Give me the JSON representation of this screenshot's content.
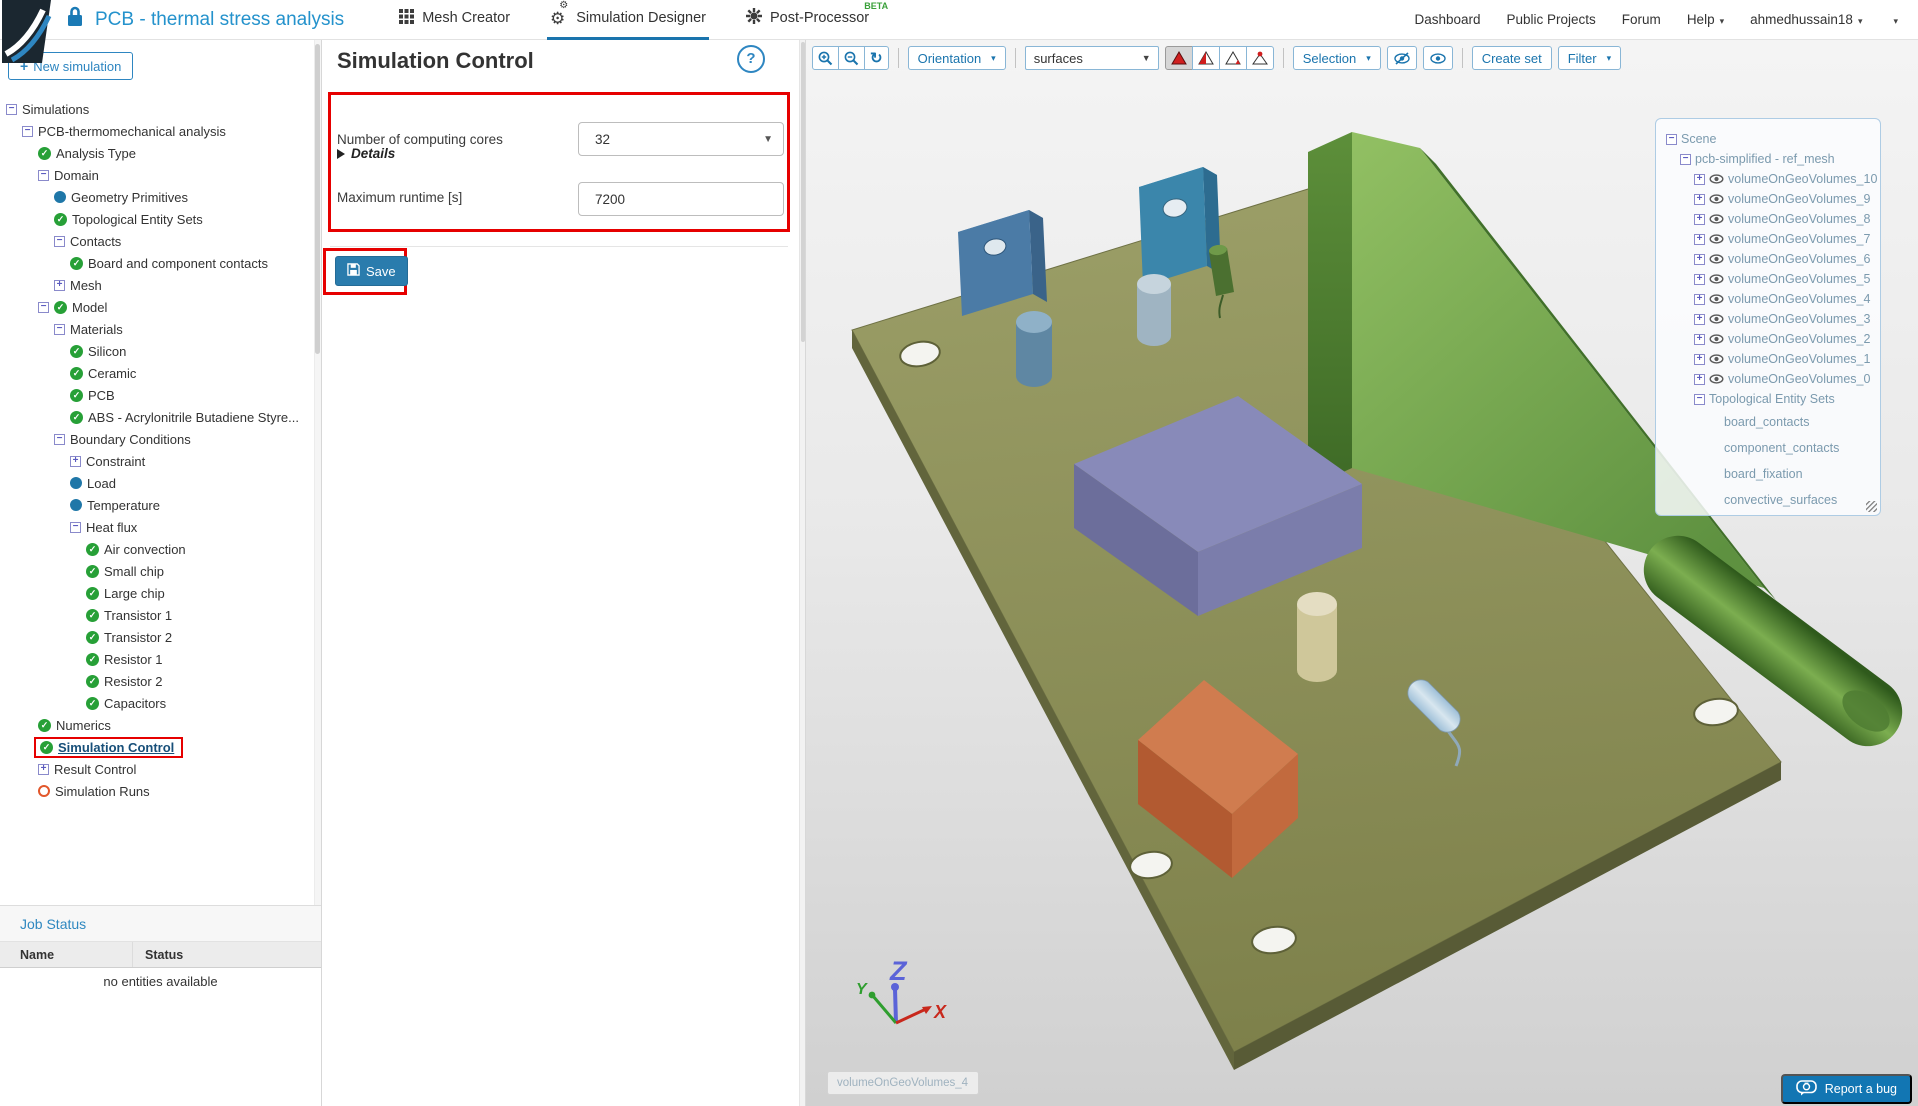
{
  "header": {
    "title": "PCB - thermal stress analysis",
    "tabs": [
      {
        "label": "Mesh Creator"
      },
      {
        "label": "Simulation Designer"
      },
      {
        "label": "Post-Processor",
        "badge": "BETA"
      }
    ],
    "nav": [
      "Dashboard",
      "Public Projects",
      "Forum",
      "Help",
      "ahmedhussain18"
    ]
  },
  "sidebar": {
    "new_simulation": "New simulation",
    "tree": [
      {
        "label": "Simulations",
        "level": 0,
        "icons": [
          "minus"
        ]
      },
      {
        "label": "PCB-thermomechanical analysis",
        "level": 1,
        "icons": [
          "minus"
        ]
      },
      {
        "label": "Analysis Type",
        "level": 2,
        "icons": [
          "check"
        ]
      },
      {
        "label": "Domain",
        "level": 2,
        "icons": [
          "minus"
        ]
      },
      {
        "label": "Geometry Primitives",
        "level": 3,
        "icons": [
          "dot"
        ]
      },
      {
        "label": "Topological Entity Sets",
        "level": 3,
        "icons": [
          "check"
        ]
      },
      {
        "label": "Contacts",
        "level": 3,
        "icons": [
          "minus"
        ]
      },
      {
        "label": "Board and component contacts",
        "level": 4,
        "icons": [
          "check"
        ]
      },
      {
        "label": "Mesh",
        "level": 3,
        "icons": [
          "plus"
        ]
      },
      {
        "label": "Model",
        "level": 2,
        "icons": [
          "minus",
          "check"
        ]
      },
      {
        "label": "Materials",
        "level": 3,
        "icons": [
          "minus"
        ]
      },
      {
        "label": "Silicon",
        "level": 4,
        "icons": [
          "check"
        ]
      },
      {
        "label": "Ceramic",
        "level": 4,
        "icons": [
          "check"
        ]
      },
      {
        "label": "PCB",
        "level": 4,
        "icons": [
          "check"
        ]
      },
      {
        "label": "ABS - Acrylonitrile Butadiene Styre...",
        "level": 4,
        "icons": [
          "check"
        ]
      },
      {
        "label": "Boundary Conditions",
        "level": 3,
        "icons": [
          "minus"
        ]
      },
      {
        "label": "Constraint",
        "level": 4,
        "icons": [
          "plus"
        ]
      },
      {
        "label": "Load",
        "level": 4,
        "icons": [
          "dot"
        ]
      },
      {
        "label": "Temperature",
        "level": 4,
        "icons": [
          "dot"
        ]
      },
      {
        "label": "Heat flux",
        "level": 4,
        "icons": [
          "minus"
        ]
      },
      {
        "label": "Air convection",
        "level": 5,
        "icons": [
          "check"
        ]
      },
      {
        "label": "Small chip",
        "level": 5,
        "icons": [
          "check"
        ]
      },
      {
        "label": "Large chip",
        "level": 5,
        "icons": [
          "check"
        ]
      },
      {
        "label": "Transistor 1",
        "level": 5,
        "icons": [
          "check"
        ]
      },
      {
        "label": "Transistor 2",
        "level": 5,
        "icons": [
          "check"
        ]
      },
      {
        "label": "Resistor 1",
        "level": 5,
        "icons": [
          "check"
        ]
      },
      {
        "label": "Resistor 2",
        "level": 5,
        "icons": [
          "check"
        ]
      },
      {
        "label": "Capacitors",
        "level": 5,
        "icons": [
          "check"
        ]
      },
      {
        "label": "Numerics",
        "level": 2,
        "icons": [
          "check"
        ]
      },
      {
        "label": "Simulation Control",
        "level": 2,
        "icons": [
          "check"
        ],
        "selected": true
      },
      {
        "label": "Result Control",
        "level": 2,
        "icons": [
          "plus"
        ]
      },
      {
        "label": "Simulation Runs",
        "level": 2,
        "icons": [
          "ring"
        ]
      }
    ],
    "job_status": {
      "title": "Job Status",
      "name_col": "Name",
      "status_col": "Status",
      "empty": "no entities available"
    }
  },
  "panel": {
    "title": "Simulation Control",
    "help": "?",
    "cores_label": "Number of computing cores",
    "cores_value": "32",
    "details_label": "Details",
    "runtime_label": "Maximum runtime [s]",
    "runtime_value": "7200",
    "save_label": "Save"
  },
  "viewport": {
    "toolbar": {
      "orientation": "Orientation",
      "surfaces": "surfaces",
      "selection": "Selection",
      "create_set": "Create set",
      "filter": "Filter"
    },
    "scene": [
      {
        "label": "Scene",
        "level": 0,
        "icons": [
          "minus"
        ]
      },
      {
        "label": "pcb-simplified - ref_mesh",
        "level": 1,
        "icons": [
          "minus"
        ]
      },
      {
        "label": "volumeOnGeoVolumes_10",
        "level": 2,
        "icons": [
          "plus",
          "eye"
        ]
      },
      {
        "label": "volumeOnGeoVolumes_9",
        "level": 2,
        "icons": [
          "plus",
          "eye"
        ]
      },
      {
        "label": "volumeOnGeoVolumes_8",
        "level": 2,
        "icons": [
          "plus",
          "eye"
        ]
      },
      {
        "label": "volumeOnGeoVolumes_7",
        "level": 2,
        "icons": [
          "plus",
          "eye"
        ]
      },
      {
        "label": "volumeOnGeoVolumes_6",
        "level": 2,
        "icons": [
          "plus",
          "eye"
        ]
      },
      {
        "label": "volumeOnGeoVolumes_5",
        "level": 2,
        "icons": [
          "plus",
          "eye"
        ]
      },
      {
        "label": "volumeOnGeoVolumes_4",
        "level": 2,
        "icons": [
          "plus",
          "eye"
        ]
      },
      {
        "label": "volumeOnGeoVolumes_3",
        "level": 2,
        "icons": [
          "plus",
          "eye"
        ]
      },
      {
        "label": "volumeOnGeoVolumes_2",
        "level": 2,
        "icons": [
          "plus",
          "eye"
        ]
      },
      {
        "label": "volumeOnGeoVolumes_1",
        "level": 2,
        "icons": [
          "plus",
          "eye"
        ]
      },
      {
        "label": "volumeOnGeoVolumes_0",
        "level": 2,
        "icons": [
          "plus",
          "eye"
        ]
      },
      {
        "label": "Topological Entity Sets",
        "level": 2,
        "icons": [
          "minus"
        ]
      },
      {
        "label": "board_contacts",
        "level": 4,
        "icons": []
      },
      {
        "label": "component_contacts",
        "level": 4,
        "icons": []
      },
      {
        "label": "board_fixation",
        "level": 4,
        "icons": []
      },
      {
        "label": "convective_surfaces",
        "level": 4,
        "icons": []
      }
    ],
    "axes": {
      "x": "X",
      "y": "Y",
      "z": "Z"
    },
    "tooltip": "volumeOnGeoVolumes_4",
    "report_bug": "Report a bug"
  },
  "icons": {
    "lock": "padlock",
    "mesh_creator": "grid",
    "simulation_designer": "gears",
    "post_processor": "gear-asterisk",
    "help": "question-circle",
    "save": "floppy-disk",
    "zoom_in": "magnifier-plus",
    "zoom_out": "magnifier-minus",
    "refresh": "circular-arrow",
    "hide": "eye-slash",
    "show": "eye",
    "report": "camera-bubble"
  },
  "colors": {
    "accent_blue": "#1a74ad",
    "title_blue": "#2492cc",
    "annotation_red": "#e60000",
    "check_green": "#27a037",
    "beta_green": "#3aa03a",
    "board_olive": "#8f925c",
    "heatsink_green": "#6b9c42"
  }
}
